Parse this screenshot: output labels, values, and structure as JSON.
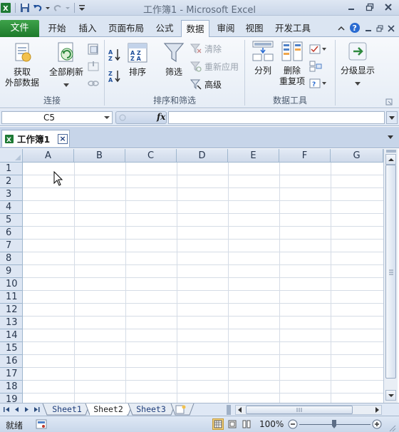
{
  "window": {
    "title": "工作簿1 - Microsoft Excel"
  },
  "ribbon_tabs": {
    "file": "文件",
    "items": [
      "开始",
      "插入",
      "页面布局",
      "公式",
      "数据",
      "审阅",
      "视图",
      "开发工具"
    ],
    "active": "数据"
  },
  "groups": {
    "connections": {
      "label": "连接",
      "get_external_line1": "获取",
      "get_external_line2": "外部数据",
      "refresh_all": "全部刷新"
    },
    "sort_filter": {
      "label": "排序和筛选",
      "sort": "排序",
      "filter": "筛选",
      "clear": "清除",
      "reapply": "重新应用",
      "advanced": "高级"
    },
    "data_tools": {
      "label": "数据工具",
      "text_to_columns": "分列",
      "remove_dup_line1": "删除",
      "remove_dup_line2": "重复项"
    },
    "outline": {
      "label": "分级显示"
    }
  },
  "formula_bar": {
    "name_box": "C5",
    "fx": "fx",
    "formula": ""
  },
  "workbook_tab": {
    "name": "工作簿1"
  },
  "grid": {
    "columns": [
      "A",
      "B",
      "C",
      "D",
      "E",
      "F",
      "G"
    ],
    "rows": [
      "1",
      "2",
      "3",
      "4",
      "5",
      "6",
      "7",
      "8",
      "9",
      "10",
      "11",
      "12",
      "13",
      "14",
      "15",
      "16",
      "17",
      "18",
      "19"
    ]
  },
  "sheets": {
    "tabs": [
      "Sheet1",
      "Sheet2",
      "Sheet3"
    ],
    "active": "Sheet2"
  },
  "status": {
    "text": "就绪",
    "zoom": "100%"
  },
  "colors": {
    "file_tab": "#217a2f",
    "header_bg": "#dde6f3",
    "grid_line": "#d5dce6"
  }
}
